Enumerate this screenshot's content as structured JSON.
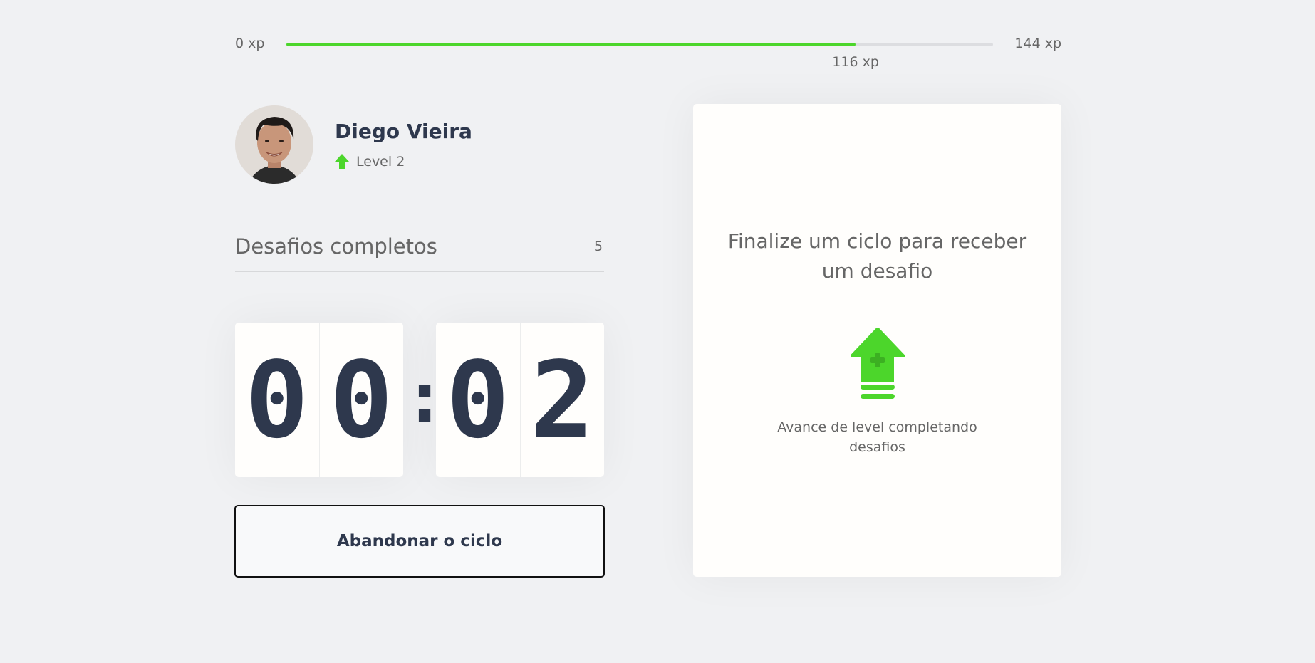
{
  "experience_bar": {
    "min_label": "0 xp",
    "max_label": "144 xp",
    "current_label": "116 xp",
    "current_xp": 116,
    "max_xp": 144
  },
  "profile": {
    "name": "Diego Vieira",
    "level_label": "Level 2",
    "level_icon": "level-up-arrow-icon",
    "avatar_description": "avatar-photo"
  },
  "completed_challenges": {
    "label": "Desafios completos",
    "count": "5"
  },
  "countdown": {
    "minute_left": "0",
    "minute_right": "0",
    "separator": ":",
    "second_left": "0",
    "second_right": "2"
  },
  "abandon_button": {
    "label": "Abandonar o ciclo"
  },
  "challenge_box": {
    "title": "Finalize um ciclo para receber um desafio",
    "icon": "level-up-icon",
    "subtitle": "Avance de level completando desafios"
  },
  "colors": {
    "background": "#f0f1f3",
    "card": "#fffefc",
    "accent_green": "#4cd62b",
    "title_dark": "#2e384d",
    "text_gray": "#666666"
  }
}
